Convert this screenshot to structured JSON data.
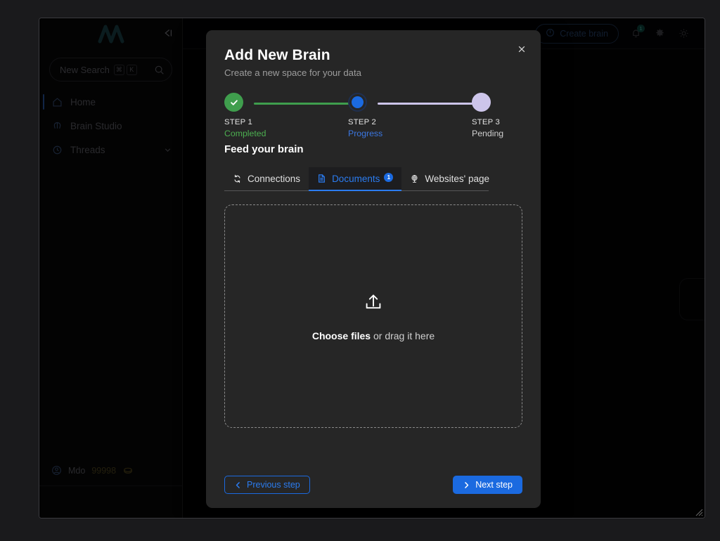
{
  "window": {
    "resize_grip": "resize-grip"
  },
  "sidebar": {
    "logo": "brand-logo",
    "collapse_icon": "collapse-sidebar-icon",
    "search": {
      "placeholder": "New Search",
      "shortcut_keys": [
        "⌘",
        "K"
      ],
      "search_icon": "search-icon"
    },
    "items": [
      {
        "label": "Home",
        "icon": "home-icon",
        "active": true
      },
      {
        "label": "Brain Studio",
        "icon": "brain-icon",
        "active": false
      },
      {
        "label": "Threads",
        "icon": "history-icon",
        "active": false,
        "chevron": "chevron-down-icon"
      }
    ],
    "user": {
      "name": "Mdo",
      "credits": "99998",
      "avatar_icon": "avatar-icon",
      "coin_icon": "coin-icon"
    }
  },
  "topbar": {
    "create_brain_label": "Create brain",
    "create_brain_icon": "power-icon",
    "notification_icon": "bell-icon",
    "notification_count": "1",
    "settings_icon": "gear-icon",
    "theme_icon": "sun-icon"
  },
  "content": {
    "ghost_card_icon": "search-icon"
  },
  "modal": {
    "title": "Add New Brain",
    "subtitle": "Create a new space for your data",
    "close_icon": "close-icon",
    "steps": [
      {
        "name": "STEP 1",
        "state": "Completed",
        "status": "done",
        "icon": "check-icon"
      },
      {
        "name": "STEP 2",
        "state": "Progress",
        "status": "progress",
        "icon": "dot-icon"
      },
      {
        "name": "STEP 3",
        "state": "Pending",
        "status": "pending",
        "icon": "dot-icon"
      }
    ],
    "section_title": "Feed your brain",
    "tabs": [
      {
        "label": "Connections",
        "icon": "sync-icon",
        "active": false,
        "badge": ""
      },
      {
        "label": "Documents",
        "icon": "document-icon",
        "active": true,
        "badge": "1"
      },
      {
        "label": "Websites' page",
        "icon": "globe-icon",
        "active": false,
        "badge": ""
      }
    ],
    "dropzone": {
      "upload_icon": "upload-icon",
      "action_text": "Choose files",
      "hint_text": " or drag it here"
    },
    "footer": {
      "previous_label": "Previous step",
      "previous_icon": "chevron-left-icon",
      "next_label": "Next step",
      "next_icon": "chevron-right-icon"
    }
  },
  "colors": {
    "accent_blue": "#1b6ae0",
    "success_green": "#4caf50",
    "pending_lavender": "#cdc5ea",
    "modal_bg": "#262626"
  }
}
